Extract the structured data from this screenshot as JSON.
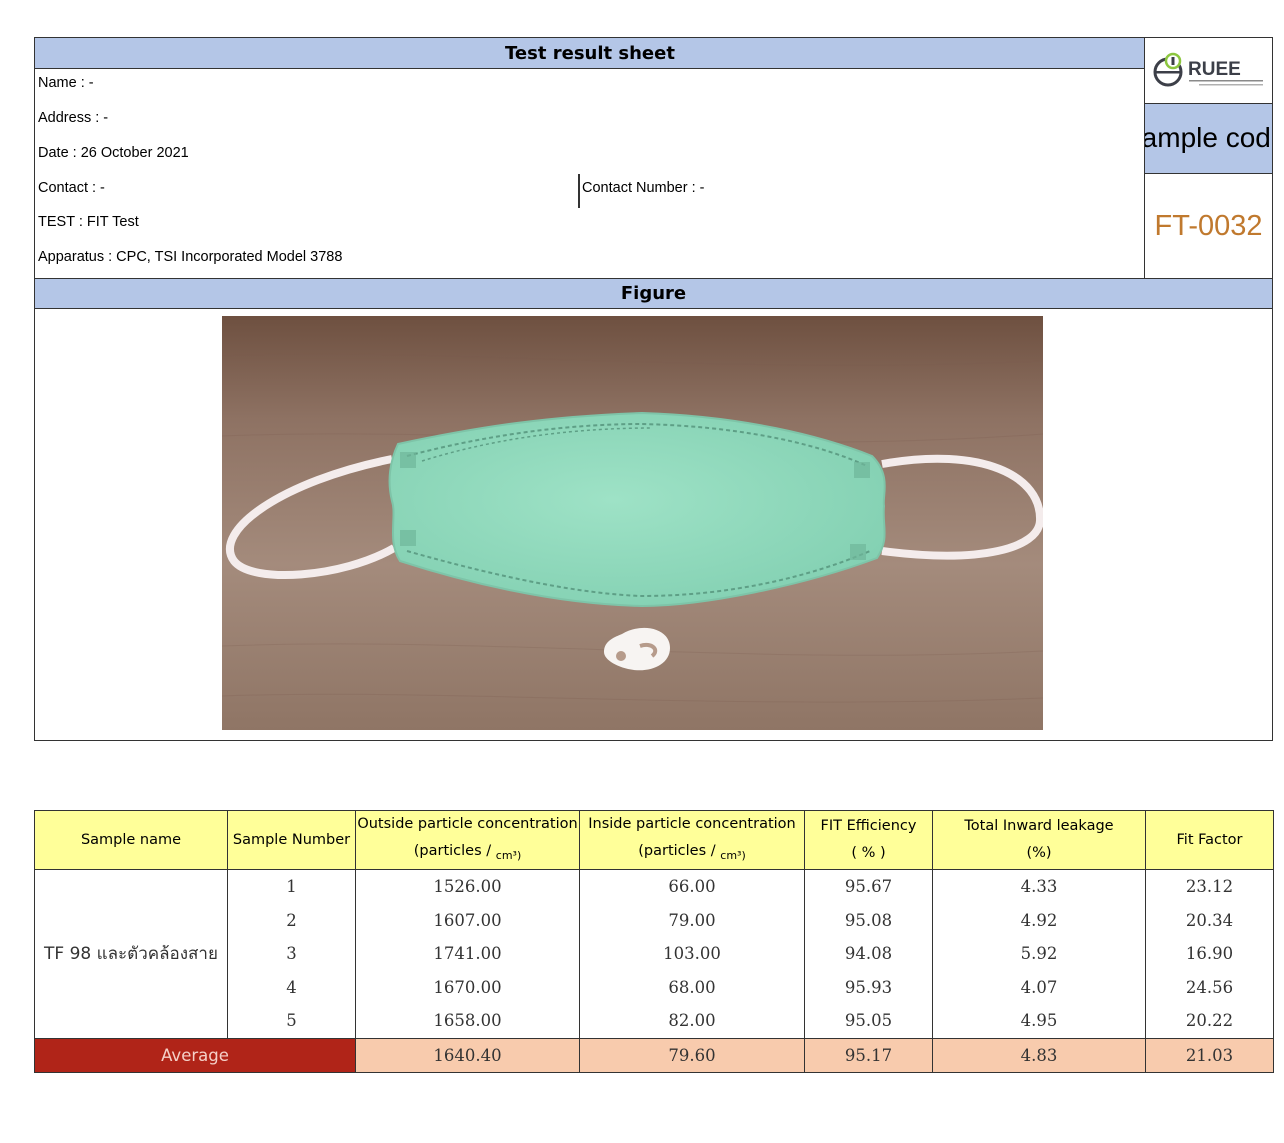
{
  "header": {
    "title": "Test result sheet",
    "name": "Name : -",
    "address": "Address : -",
    "date": "Date : 26 October 2021",
    "contact": "Contact : -",
    "contact_number": "Contact Number : -",
    "test": "TEST : FIT Test",
    "apparatus": "Apparatus : CPC, TSI Incorporated Model 3788",
    "sample_code_label": "Sample code",
    "sample_code_value": "FT-0032",
    "logo_text": "RUEE"
  },
  "figure": {
    "title": "Figure"
  },
  "table": {
    "headers": {
      "sample_name": "Sample name",
      "sample_number": "Sample Number",
      "outside_line1": "Outside particle concentration",
      "outside_line2": "(particles /",
      "inside_line1": "Inside particle concentration",
      "inside_line2": "(particles /",
      "unit": "cm³)",
      "efficiency_line1": "FIT Efficiency",
      "efficiency_line2": "( % )",
      "leakage_line1": "Total Inward leakage",
      "leakage_line2": "(%)",
      "fit_factor": "Fit Factor"
    },
    "sample_name": "TF 98 และตัวคล้องสาย",
    "rows": [
      {
        "number": "1",
        "outside": "1526.00",
        "inside": "66.00",
        "efficiency": "95.67",
        "leakage": "4.33",
        "fit_factor": "23.12"
      },
      {
        "number": "2",
        "outside": "1607.00",
        "inside": "79.00",
        "efficiency": "95.08",
        "leakage": "4.92",
        "fit_factor": "20.34"
      },
      {
        "number": "3",
        "outside": "1741.00",
        "inside": "103.00",
        "efficiency": "94.08",
        "leakage": "5.92",
        "fit_factor": "16.90"
      },
      {
        "number": "4",
        "outside": "1670.00",
        "inside": "68.00",
        "efficiency": "95.93",
        "leakage": "4.07",
        "fit_factor": "24.56"
      },
      {
        "number": "5",
        "outside": "1658.00",
        "inside": "82.00",
        "efficiency": "95.05",
        "leakage": "4.95",
        "fit_factor": "20.22"
      }
    ],
    "average": {
      "label": "Average",
      "outside": "1640.40",
      "inside": "79.60",
      "efficiency": "95.17",
      "leakage": "4.83",
      "fit_factor": "21.03"
    }
  },
  "colors": {
    "header_band": "#b4c6e7",
    "table_header": "#ffff99",
    "average_row": "#f8cbad",
    "average_label": "#b02418",
    "sample_code": "#c0792e",
    "mask": "#8fd8bb"
  }
}
